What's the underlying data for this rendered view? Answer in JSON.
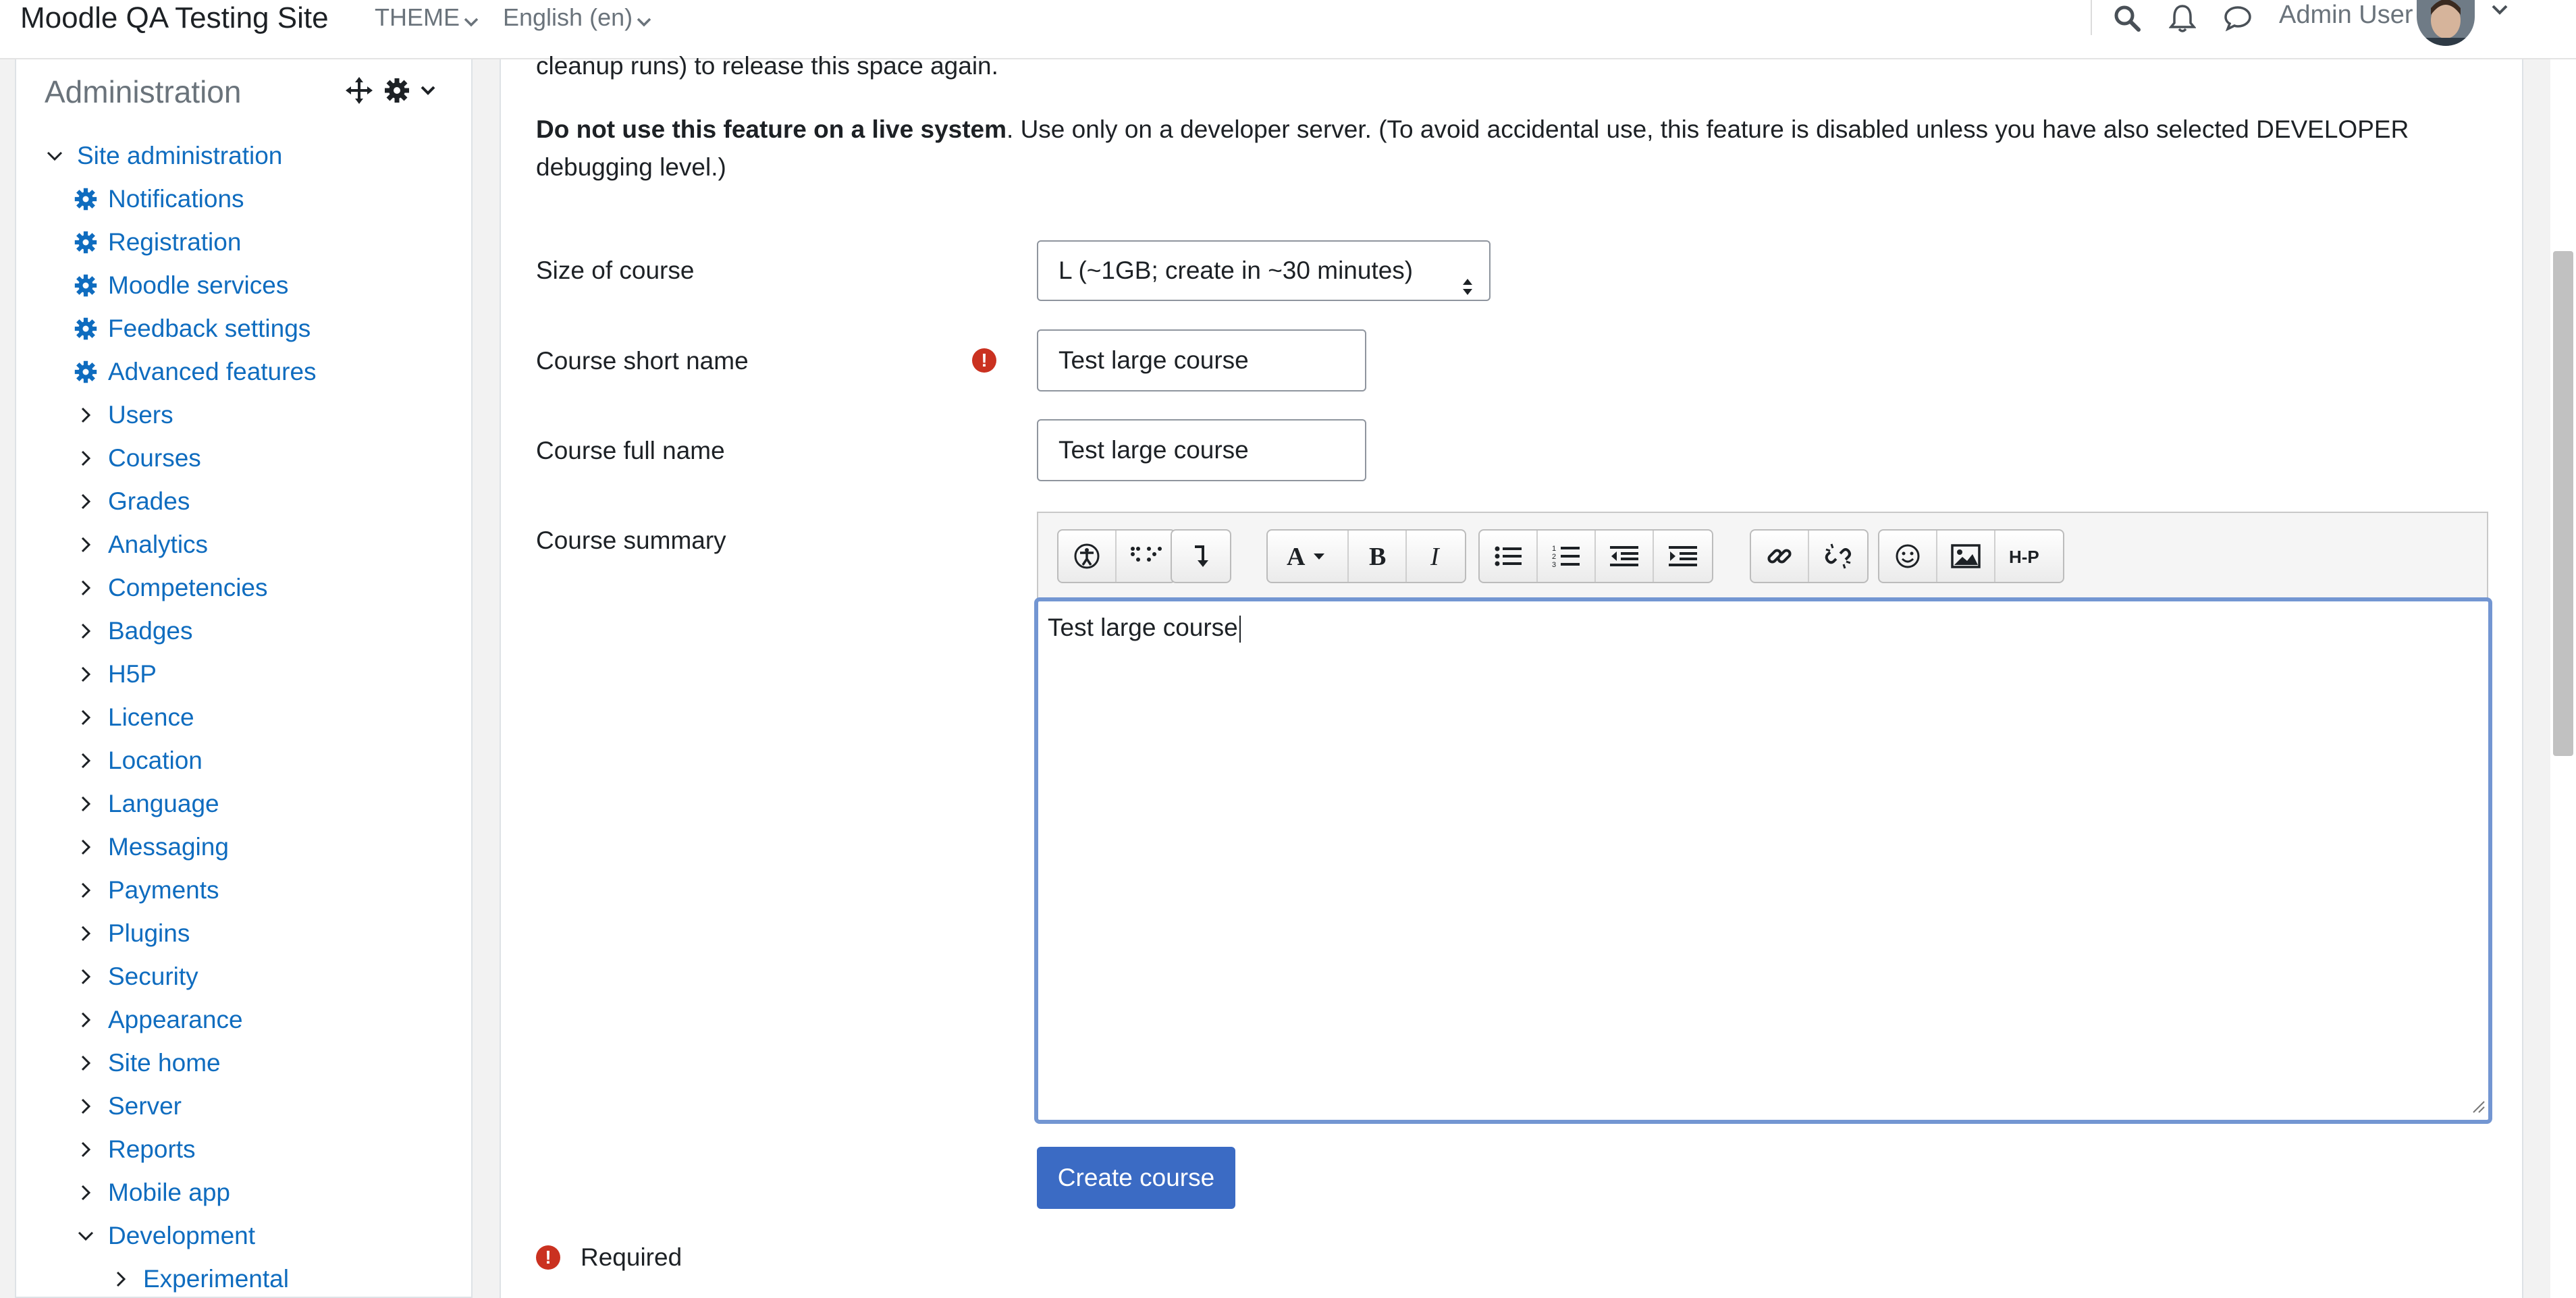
{
  "navbar": {
    "site_name": "Moodle QA Testing Site",
    "theme_menu": "THEME",
    "language_menu": "English (en)",
    "user_name": "Admin User"
  },
  "admin_block": {
    "title": "Administration",
    "items": [
      {
        "label": "Site administration",
        "kind": "expanded"
      },
      {
        "label": "Notifications",
        "kind": "gear"
      },
      {
        "label": "Registration",
        "kind": "gear"
      },
      {
        "label": "Moodle services",
        "kind": "gear"
      },
      {
        "label": "Feedback settings",
        "kind": "gear"
      },
      {
        "label": "Advanced features",
        "kind": "gear"
      },
      {
        "label": "Users",
        "kind": "collapsed"
      },
      {
        "label": "Courses",
        "kind": "collapsed"
      },
      {
        "label": "Grades",
        "kind": "collapsed"
      },
      {
        "label": "Analytics",
        "kind": "collapsed"
      },
      {
        "label": "Competencies",
        "kind": "collapsed"
      },
      {
        "label": "Badges",
        "kind": "collapsed"
      },
      {
        "label": "H5P",
        "kind": "collapsed"
      },
      {
        "label": "Licence",
        "kind": "collapsed"
      },
      {
        "label": "Location",
        "kind": "collapsed"
      },
      {
        "label": "Language",
        "kind": "collapsed"
      },
      {
        "label": "Messaging",
        "kind": "collapsed"
      },
      {
        "label": "Payments",
        "kind": "collapsed"
      },
      {
        "label": "Plugins",
        "kind": "collapsed"
      },
      {
        "label": "Security",
        "kind": "collapsed"
      },
      {
        "label": "Appearance",
        "kind": "collapsed"
      },
      {
        "label": "Site home",
        "kind": "collapsed"
      },
      {
        "label": "Server",
        "kind": "collapsed"
      },
      {
        "label": "Reports",
        "kind": "collapsed"
      },
      {
        "label": "Mobile app",
        "kind": "collapsed"
      },
      {
        "label": "Development",
        "kind": "expanded"
      },
      {
        "label": "Experimental",
        "kind": "collapsed"
      }
    ]
  },
  "main": {
    "intro_partial": "cleanup runs) to release this space again.",
    "warning_bold": "Do not use this feature on a live system",
    "warning_line1": ". Use only on a developer server. (To avoid accidental use, this feature is disabled unless you have also selected DEVELOPER",
    "warning_line2": "debugging level.)",
    "form": {
      "size_label": "Size of course",
      "size_value": "L (~1GB; create in ~30 minutes)",
      "shortname_label": "Course short name",
      "shortname_value": "Test large course",
      "fullname_label": "Course full name",
      "fullname_value": "Test large course",
      "summary_label": "Course summary",
      "summary_value": "Test large course",
      "submit_label": "Create course",
      "required_legend": "Required"
    }
  },
  "colors": {
    "link": "#0f6cbf",
    "primary_button": "#3b6bc4",
    "required": "#ca3120",
    "editor_focus": "#7396d2"
  }
}
